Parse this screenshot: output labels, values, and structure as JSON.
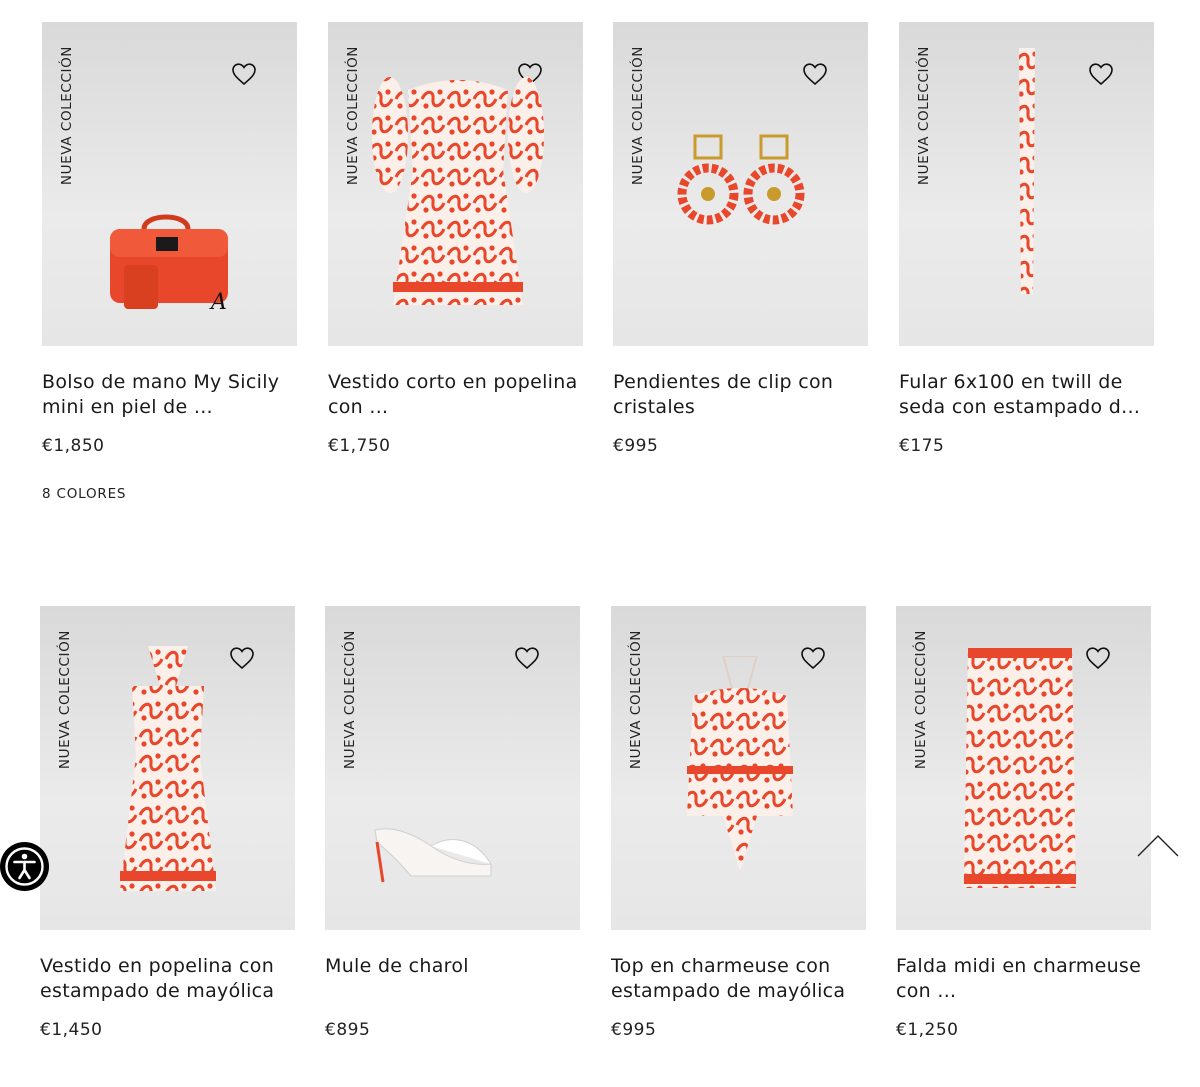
{
  "badge_new": "NUEVA COLECCIÓN",
  "colors": {
    "accent": "#e8472b",
    "background_card": "#e3e3e3"
  },
  "products": [
    {
      "name": "Bolso de mano My Sicily mini en piel de ...",
      "price": "€1,850",
      "colors_label": "8 COLORES"
    },
    {
      "name": "Vestido corto en popelina con ...",
      "price": "€1,750"
    },
    {
      "name": "Pendientes de clip con cristales",
      "price": "€995"
    },
    {
      "name": "Fular 6x100 en twill de seda con estampado d...",
      "price": "€175"
    },
    {
      "name": "Vestido en popelina con estampado de mayólica",
      "price": "€1,450"
    },
    {
      "name": "Mule de charol",
      "price": "€895"
    },
    {
      "name": "Top en charmeuse con estampado de mayólica",
      "price": "€995"
    },
    {
      "name": "Falda midi en charmeuse con ...",
      "price": "€1,250"
    }
  ],
  "icons": {
    "wishlist": "heart-icon",
    "accessibility": "accessibility-icon",
    "scroll_top": "chevron-up-icon"
  }
}
